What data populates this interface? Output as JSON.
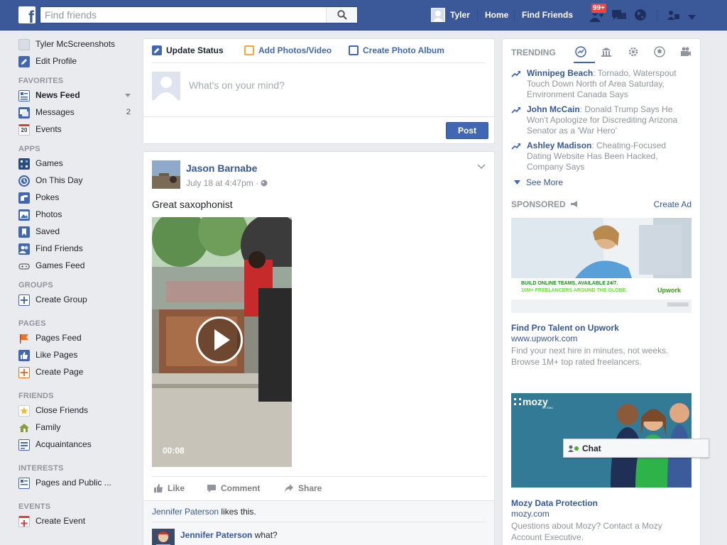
{
  "topbar": {
    "search_placeholder": "Find friends",
    "user_name": "Tyler",
    "home": "Home",
    "find_friends": "Find Friends",
    "notification_count": "99+"
  },
  "leftnav": {
    "profile": {
      "name": "Tyler McScreenshots",
      "edit": "Edit Profile"
    },
    "favorites": {
      "header": "FAVORITES",
      "items": [
        {
          "label": "News Feed",
          "icon": "news-feed-icon"
        },
        {
          "label": "Messages",
          "icon": "messages-icon",
          "count": "2"
        },
        {
          "label": "Events",
          "icon": "calendar-icon",
          "icon_text": "20"
        }
      ]
    },
    "apps": {
      "header": "APPS",
      "items": [
        {
          "label": "Games",
          "icon": "games-icon"
        },
        {
          "label": "On This Day",
          "icon": "on-this-day-icon"
        },
        {
          "label": "Pokes",
          "icon": "pokes-icon"
        },
        {
          "label": "Photos",
          "icon": "photos-icon"
        },
        {
          "label": "Saved",
          "icon": "saved-icon"
        },
        {
          "label": "Find Friends",
          "icon": "find-friends-icon"
        },
        {
          "label": "Games Feed",
          "icon": "games-feed-icon"
        }
      ]
    },
    "groups": {
      "header": "GROUPS",
      "items": [
        {
          "label": "Create Group",
          "icon": "create-group-icon"
        }
      ]
    },
    "pages": {
      "header": "PAGES",
      "items": [
        {
          "label": "Pages Feed",
          "icon": "pages-feed-icon"
        },
        {
          "label": "Like Pages",
          "icon": "like-pages-icon"
        },
        {
          "label": "Create Page",
          "icon": "create-page-icon"
        }
      ]
    },
    "friends": {
      "header": "FRIENDS",
      "items": [
        {
          "label": "Close Friends",
          "icon": "close-friends-icon"
        },
        {
          "label": "Family",
          "icon": "family-icon"
        },
        {
          "label": "Acquaintances",
          "icon": "acquaintances-icon"
        }
      ]
    },
    "interests": {
      "header": "INTERESTS",
      "items": [
        {
          "label": "Pages and Public ...",
          "icon": "pages-public-icon"
        }
      ]
    },
    "events": {
      "header": "EVENTS",
      "items": [
        {
          "label": "Create Event",
          "icon": "create-event-icon"
        }
      ]
    }
  },
  "composer": {
    "tabs": [
      "Update Status",
      "Add Photos/Video",
      "Create Photo Album"
    ],
    "placeholder": "What's on your mind?",
    "post_button": "Post"
  },
  "post": {
    "author": "Jason Barnabe",
    "timestamp": "July 18 at 4:47pm",
    "text": "Great saxophonist",
    "video_duration": "00:08",
    "actions": [
      "Like",
      "Comment",
      "Share"
    ],
    "likes_name": "Jennifer Paterson",
    "likes_suffix": " likes this.",
    "comment": {
      "author": "Jennifer Paterson",
      "text": " what?"
    }
  },
  "trending": {
    "header": "TRENDING",
    "items": [
      {
        "title": "Winnipeg Beach",
        "text": ": Tornado, Waterspout Touch Down North of Area Saturday, Environment Canada Says"
      },
      {
        "title": "John McCain",
        "text": ": Donald Trump Says He Won't Apologize for Discrediting Arizona Senator as a 'War Hero'"
      },
      {
        "title": "Ashley Madison",
        "text": ": Cheating-Focused Dating Website Has Been Hacked, Company Says"
      }
    ],
    "see_more": "See More"
  },
  "sponsored": {
    "header": "SPONSORED",
    "create_ad": "Create Ad",
    "ads": [
      {
        "banner_line1": "BUILD ONLINE TEAMS, AVAILABLE 24/7.",
        "banner_line2": "10M+ FREELANCERS AROUND THE GLOBE.",
        "banner_brand": "Upwork",
        "title": "Find Pro Talent on Upwork",
        "url": "www.upwork.com",
        "desc": "Find your next hire in minutes, not weeks. Browse 1M+ top rated freelancers."
      },
      {
        "banner_brand": "mozy",
        "banner_brand_sub": "BY EMC",
        "title": "Mozy Data Protection",
        "url": "mozy.com",
        "desc": "Questions about Mozy? Contact a Mozy Account Executive."
      }
    ]
  },
  "chat": {
    "label": "Chat"
  },
  "colors": {
    "brand": "#3b5998",
    "link": "#365899",
    "accent": "#4267b2",
    "badge": "#fa3e3e",
    "page_bg": "#e9ebee"
  }
}
